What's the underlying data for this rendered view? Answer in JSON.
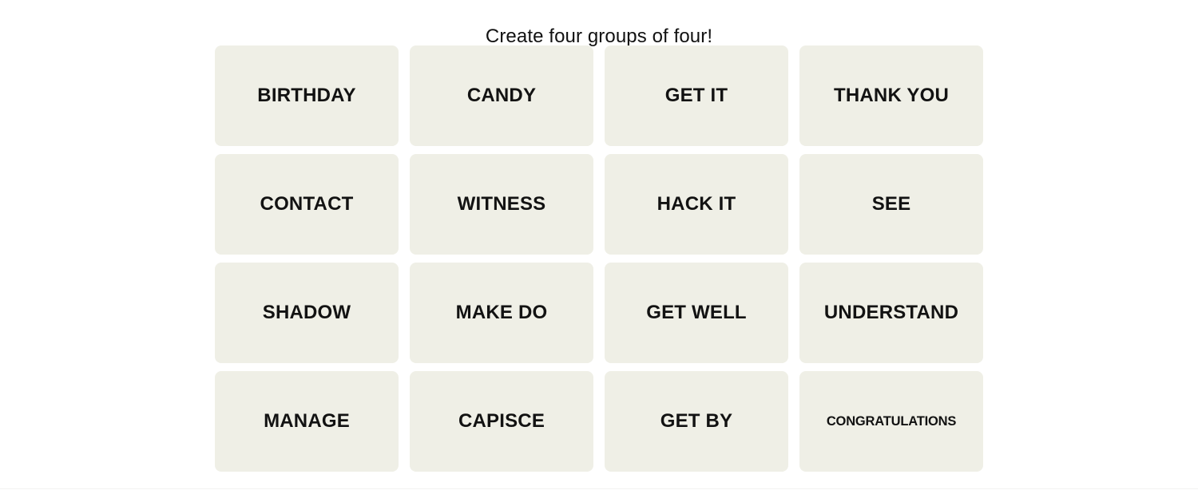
{
  "header": {
    "title": "Create four groups of four!"
  },
  "colors": {
    "page_background": "#ffffff",
    "tile_background": "#efefe6",
    "tile_text": "#121212",
    "title_text": "#121212",
    "bottom_rule": "#f3f3f1"
  },
  "board": {
    "rows": 4,
    "columns": 4,
    "tiles": [
      {
        "label": "BIRTHDAY",
        "size": "md"
      },
      {
        "label": "CANDY",
        "size": "md"
      },
      {
        "label": "GET IT",
        "size": "md"
      },
      {
        "label": "THANK YOU",
        "size": "md"
      },
      {
        "label": "CONTACT",
        "size": "md"
      },
      {
        "label": "WITNESS",
        "size": "md"
      },
      {
        "label": "HACK IT",
        "size": "md"
      },
      {
        "label": "SEE",
        "size": "md"
      },
      {
        "label": "SHADOW",
        "size": "md"
      },
      {
        "label": "MAKE DO",
        "size": "md"
      },
      {
        "label": "GET WELL",
        "size": "md"
      },
      {
        "label": "UNDERSTAND",
        "size": "md"
      },
      {
        "label": "MANAGE",
        "size": "md"
      },
      {
        "label": "CAPISCE",
        "size": "md"
      },
      {
        "label": "GET BY",
        "size": "md"
      },
      {
        "label": "CONGRATULATIONS",
        "size": "xs"
      }
    ]
  }
}
